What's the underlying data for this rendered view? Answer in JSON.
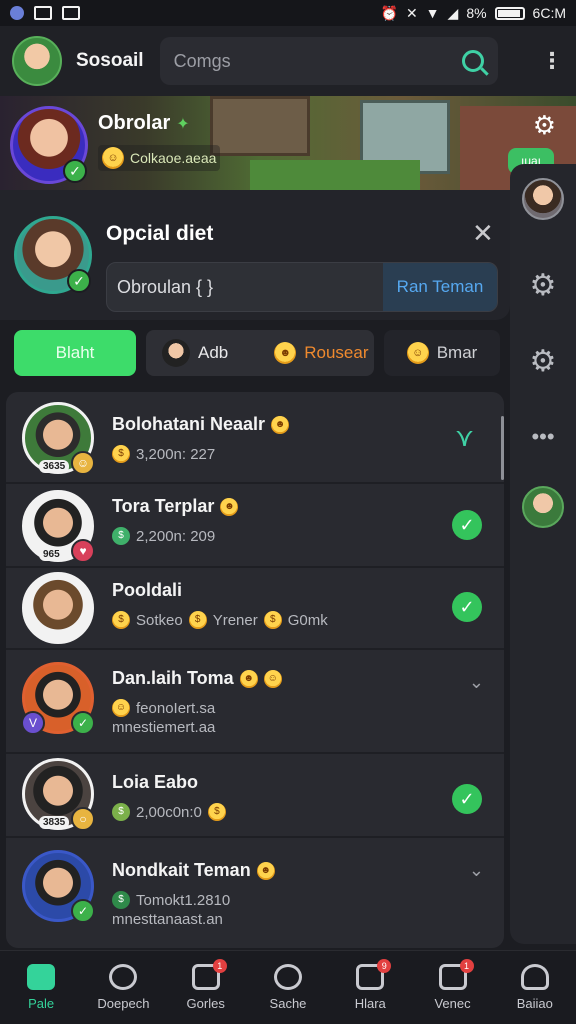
{
  "status_bar": {
    "battery_text": "8%",
    "time": "6C:M"
  },
  "app": {
    "title": "Sosoail"
  },
  "search": {
    "placeholder": "Comgs"
  },
  "banner": {
    "name": "Obrolar",
    "subtitle": "Colkaoe.aeaa",
    "pill": "ıuaı"
  },
  "composer": {
    "title": "Opcial diet",
    "input_value": "Obroulan { }",
    "button_label": "Ran Teman"
  },
  "chips": {
    "start": "Blaht",
    "add": "Adb",
    "orange": "Rousear",
    "last": "Bmar"
  },
  "list": [
    {
      "name": "Bolohatani Neaalr",
      "meta": "3,200n: 227",
      "meta2": "",
      "badge": "3635",
      "status": "caret"
    },
    {
      "name": "Tora Terplar",
      "meta": "2,200n: 209",
      "meta2": "",
      "badge": "965",
      "status": "check"
    },
    {
      "name": "Pooldali",
      "meta": "Sotkeo",
      "meta_b": "Yrener",
      "meta_c": "G0mk",
      "meta2": "",
      "badge": "",
      "status": "check"
    },
    {
      "name": "Dan.laih Toma",
      "meta": "feonoIert.sa",
      "meta2": "mnestiemert.aa",
      "badge": "",
      "status": "chevron"
    },
    {
      "name": "Loia Eabo",
      "meta": "2,00c0n:0",
      "meta2": "",
      "badge": "3835",
      "status": "check"
    },
    {
      "name": "Nondkait Teman",
      "meta": "Tomokt1.2810",
      "meta2": "mnesttanaast.an",
      "badge": "",
      "status": "chevron"
    }
  ],
  "bottom_nav": [
    {
      "label": "Pale",
      "icon": "home-icon",
      "active": true
    },
    {
      "label": "Doepech",
      "icon": "search-icon",
      "active": false,
      "dot": ""
    },
    {
      "label": "Gorles",
      "icon": "gamepad-icon",
      "active": false,
      "dot": "1"
    },
    {
      "label": "Sache",
      "icon": "explore-icon",
      "active": false,
      "dot": ""
    },
    {
      "label": "Hlara",
      "icon": "dice-icon",
      "active": false,
      "dot": "9"
    },
    {
      "label": "Venec",
      "icon": "inbox-icon",
      "active": false,
      "dot": "1"
    },
    {
      "label": "Baiiao",
      "icon": "profile-icon",
      "active": false,
      "dot": ""
    }
  ],
  "colors": {
    "accent": "#34d39a",
    "primary_green": "#3ddc6a",
    "check_green": "#34c45c",
    "link_blue": "#56a8f0",
    "orange": "#f08a2e",
    "background": "#1c1d22"
  }
}
